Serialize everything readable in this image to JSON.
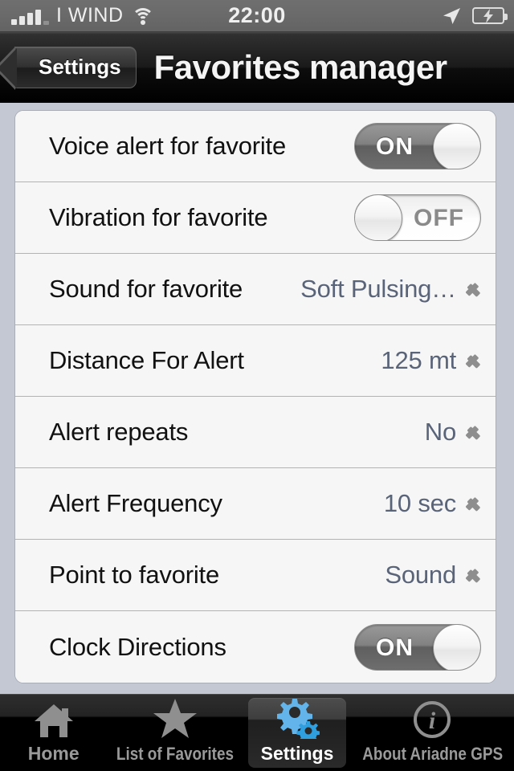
{
  "status_bar": {
    "carrier": "I WIND",
    "time": "22:00",
    "signal_icon": "signal-bars-icon",
    "wifi_icon": "wifi-icon",
    "location_icon": "location-arrow-icon",
    "battery_icon": "battery-charging-icon"
  },
  "nav": {
    "back_label": "Settings",
    "title": "Favorites manager"
  },
  "settings": {
    "rows": [
      {
        "label": "Voice alert for favorite",
        "type": "switch",
        "value": "ON",
        "state": "on"
      },
      {
        "label": "Vibration for favorite",
        "type": "switch",
        "value": "OFF",
        "state": "off"
      },
      {
        "label": "Sound for favorite",
        "type": "disclosure",
        "value": "Soft Pulsing…"
      },
      {
        "label": "Distance For Alert",
        "type": "disclosure",
        "value": "125 mt"
      },
      {
        "label": "Alert repeats",
        "type": "disclosure",
        "value": "No"
      },
      {
        "label": "Alert Frequency",
        "type": "disclosure",
        "value": "10 sec"
      },
      {
        "label": "Point to favorite",
        "type": "disclosure",
        "value": "Sound"
      },
      {
        "label": "Clock Directions",
        "type": "switch",
        "value": "ON",
        "state": "on"
      }
    ]
  },
  "tabbar": {
    "items": [
      {
        "label": "Home",
        "icon": "house-icon",
        "active": false
      },
      {
        "label": "List of Favorites",
        "icon": "star-icon",
        "active": false
      },
      {
        "label": "Settings",
        "icon": "gears-icon",
        "active": true
      },
      {
        "label": "About Ariadne GPS",
        "icon": "info-circle-icon",
        "active": false
      }
    ]
  },
  "colors": {
    "page_background": "#c3c8d2",
    "row_background": "#f6f6f6",
    "value_text": "#5a6478",
    "accent_blue": "#4aa3e0",
    "navbar": "#1a1a1a"
  }
}
